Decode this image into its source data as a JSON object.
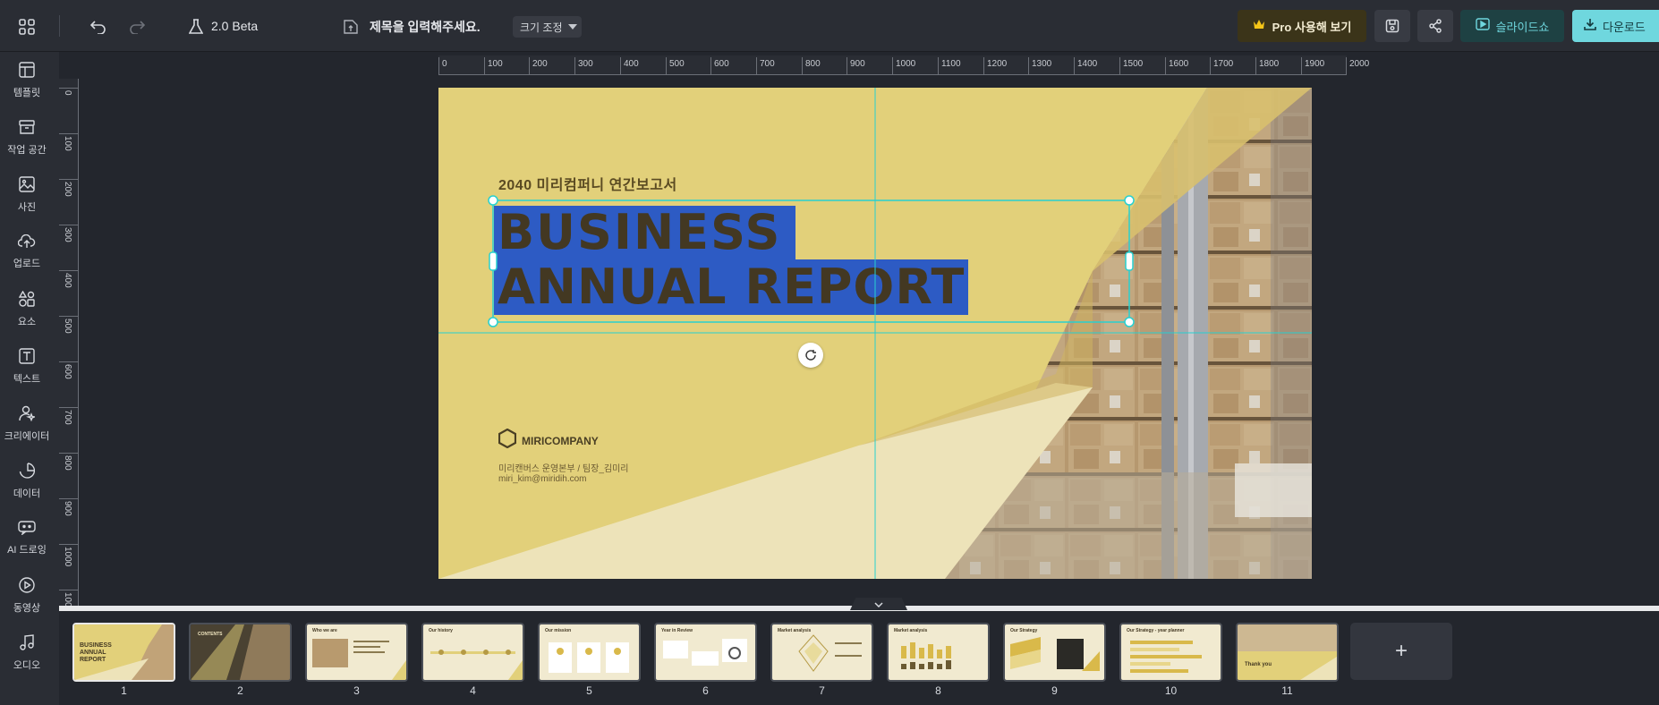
{
  "topbar": {
    "version": "2.0 Beta",
    "title_placeholder": "제목을 입력해주세요.",
    "resize_label": "크기 조정",
    "pro_label": "Pro 사용해 보기",
    "slideshow_label": "슬라이드쇼",
    "download_label": "다운로드"
  },
  "sidebar": {
    "items": [
      {
        "label": "템플릿",
        "icon": "template-icon"
      },
      {
        "label": "작업 공간",
        "icon": "archive-icon"
      },
      {
        "label": "사진",
        "icon": "image-icon"
      },
      {
        "label": "업로드",
        "icon": "cloud-upload-icon"
      },
      {
        "label": "요소",
        "icon": "shapes-icon"
      },
      {
        "label": "텍스트",
        "icon": "text-icon"
      },
      {
        "label": "크리에이터",
        "icon": "creator-icon"
      },
      {
        "label": "데이터",
        "icon": "chart-icon"
      },
      {
        "label": "AI 드로잉",
        "icon": "ai-drawing-icon"
      },
      {
        "label": "동영상",
        "icon": "play-icon"
      },
      {
        "label": "오디오",
        "icon": "music-icon"
      }
    ]
  },
  "ruler": {
    "h_labels": [
      "0",
      "100",
      "200",
      "300",
      "400",
      "500",
      "600",
      "700",
      "800",
      "900",
      "1000",
      "1100",
      "1200",
      "1300",
      "1400",
      "1500",
      "1600",
      "1700",
      "1800",
      "1900",
      "2000"
    ],
    "v_labels": [
      "0",
      "100",
      "200",
      "300",
      "400",
      "500",
      "600",
      "700",
      "800",
      "900",
      "1000",
      "100"
    ]
  },
  "slide": {
    "subtitle": "2040 미리컴퍼니 연간보고서",
    "title_line1": "BUSINESS",
    "title_line2": "ANNUAL REPORT",
    "company": "MIRICOMPANY",
    "author": "미리캔버스 운영본부 / 팀장_김미리",
    "email": "miri_kim@miridih.com"
  },
  "colors": {
    "slide_yellow": "#e2d07a",
    "light_wedge": "#ede3b9",
    "text_selection": "#2d5bc4",
    "guide_cyan": "#27d0d0",
    "pro_gold": "#f5c518",
    "download_bg": "#6fd7de"
  },
  "thumbnails": [
    {
      "num": "1",
      "caption": "BUSINESS ANNUAL REPORT",
      "selected": true
    },
    {
      "num": "2",
      "caption": "CONTENTS"
    },
    {
      "num": "3",
      "caption": "Who we are"
    },
    {
      "num": "4",
      "caption": "Our history"
    },
    {
      "num": "5",
      "caption": "Our mission"
    },
    {
      "num": "6",
      "caption": "Year in Review"
    },
    {
      "num": "7",
      "caption": "Market analysis"
    },
    {
      "num": "8",
      "caption": "Market analysis"
    },
    {
      "num": "9",
      "caption": "Our Strategy"
    },
    {
      "num": "10",
      "caption": "Our Strategy - year planner"
    },
    {
      "num": "11",
      "caption": "Thank you"
    }
  ],
  "add_page": "+"
}
